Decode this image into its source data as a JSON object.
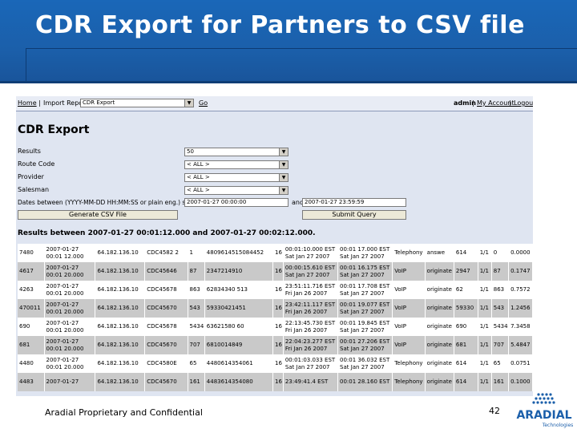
{
  "slide": {
    "title": "CDR Export for Partners to CSV file",
    "footer": "Aradial Proprietary and Confidential",
    "page_number": "42",
    "logo_text": "ARADIAL",
    "logo_subtext": "Technologies"
  },
  "app": {
    "nav": {
      "home": "Home",
      "sep": "|",
      "reports": "Import Report",
      "report_select": "CDR Export",
      "go": "Go",
      "admin": "admin",
      "my_account": "My Account",
      "logout": "Logout"
    },
    "page_title": "CDR Export",
    "form": {
      "results_label": "Results",
      "results_value": "50",
      "route_code_label": "Route Code",
      "route_code_value": "< ALL >",
      "provider_label": "Provider",
      "provider_value": "< ALL >",
      "salesman_label": "Salesman",
      "salesman_value": "< ALL >",
      "date_label": "Dates between (YYYY-MM-DD HH:MM:SS or plain eng.) sty",
      "start_date": "2007-01-27 00:00:00",
      "and_label": "and",
      "end_date": "2007-01-27 23:59:59",
      "generate_button": "Generate CSV File",
      "submit_button": "Submit Query"
    },
    "results_heading": "Results between 2007-01-27 00:01:12.000 and 2007-01-27 00:02:12.000.",
    "rows": [
      [
        "7480",
        "2007-01-27 00:01 12.000",
        "64.182.136.10",
        "CDC4582 2",
        "1",
        "4809614515084452",
        "16",
        "00:01:10.000 EST Sat Jan 27 2007",
        "00:01 17.000 EST Sat Jan 27 2007",
        "Telephony",
        "answe",
        "614",
        "1/1",
        "0",
        "0.0000"
      ],
      [
        "4617",
        "2007-01-27 00:01 20.000",
        "64.182.136.10",
        "CDC45646",
        "87",
        "2347214910",
        "16",
        "00:00:15.610 EST Sat Jan 27 2007",
        "00:01 16.175 EST Sat Jan 27 2007",
        "VoIP",
        "originate",
        "2947",
        "1/1",
        "87",
        "0.1747"
      ],
      [
        "4263",
        "2007-01-27 00:01 20.000",
        "64.182.136.10",
        "CDC45678",
        "863",
        "62834340 513",
        "16",
        "23:51:11.716 EST Fri Jan 26 2007",
        "00:01 17.708 EST Sat Jan 27 2007",
        "VoIP",
        "originate",
        "62",
        "1/1",
        "863",
        "0.7572"
      ],
      [
        "470011",
        "2007-01-27 00:01 20.000",
        "64.182.136.10",
        "CDC45670",
        "543",
        "59330421451",
        "16",
        "23:42:11.117 EST Fri Jan 26 2007",
        "00:01 19.077 EST Sat Jan 27 2007",
        "VoIP",
        "originate",
        "59330",
        "1/1",
        "543",
        "1.2456"
      ],
      [
        "690",
        "2007-01-27 00:01 20.000",
        "64.182.136.10",
        "CDC45678",
        "5434",
        "63621580 60",
        "16",
        "22:13:45.730 EST Fri Jan 26 2007",
        "00:01 19.845 EST Sat Jan 27 2007",
        "VoIP",
        "originate",
        "690",
        "1/1",
        "5434",
        "7.3458"
      ],
      [
        "681",
        "2007-01-27 00:01 20.000",
        "64.182.136.10",
        "CDC45670",
        "707",
        "6810014849",
        "16",
        "22:04:23.277 EST Fri Jan 26 2007",
        "00:01 27.206 EST Sat Jan 27 2007",
        "VoIP",
        "originate",
        "681",
        "1/1",
        "707",
        "5.4847"
      ],
      [
        "4480",
        "2007-01-27 00:01 20.000",
        "64.182.136.10",
        "CDC4580E",
        "65",
        "4480614354061",
        "16",
        "00:01:03.033 EST Sat Jan 27 2007",
        "00:01 36.032 EST Sat Jan 27 2007",
        "Telephony",
        "originate",
        "614",
        "1/1",
        "65",
        "0.0751"
      ],
      [
        "4483",
        "2007-01-27",
        "64.182.136.10",
        "CDC45670",
        "161",
        "4483614354080",
        "16",
        "23:49:41.4 EST",
        "00:01 28.160 EST",
        "Telephony",
        "originate",
        "614",
        "1/1",
        "161",
        "0.1000"
      ]
    ]
  },
  "colors": {
    "header_blue": "#1b5faa",
    "app_background": "#dfe5f1",
    "row_gray": "#c9c9c9"
  }
}
